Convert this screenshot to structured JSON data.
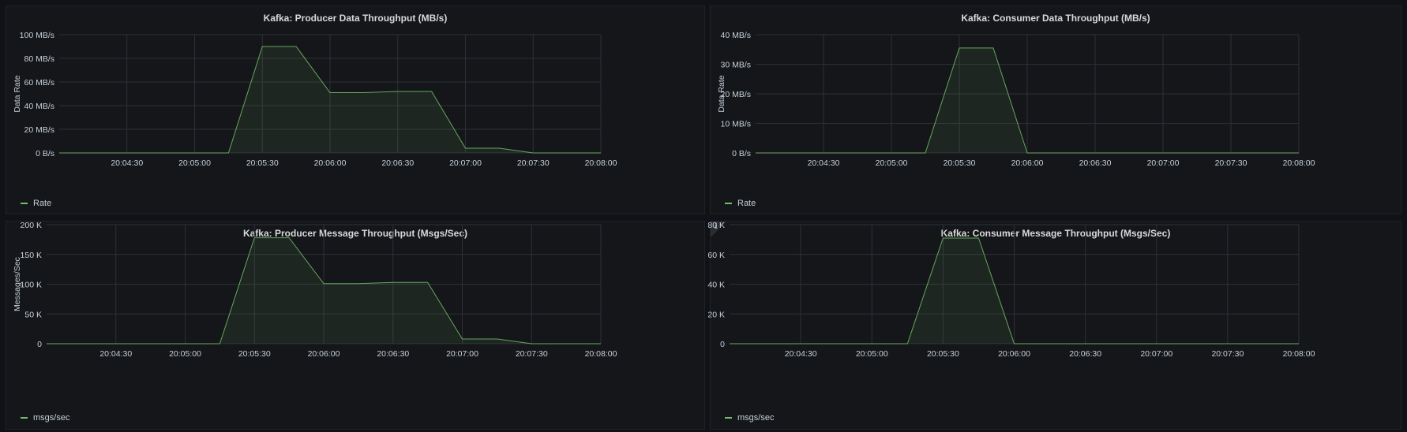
{
  "theme": {
    "background": "#111217",
    "panel_background": "#141619",
    "series_color": "#73bf69",
    "grid_color": "#2c3036",
    "text_color": "#c7d0d9"
  },
  "panels": [
    {
      "title": "Kafka: Producer Data Throughput (MB/s)",
      "legend_label": "Rate",
      "has_info_icon": false,
      "info_icon": ""
    },
    {
      "title": "Kafka: Consumer Data Throughput (MB/s)",
      "legend_label": "Rate",
      "has_info_icon": false,
      "info_icon": ""
    },
    {
      "title": "Kafka: Producer Message Throughput (Msgs/Sec)",
      "legend_label": "msgs/sec",
      "has_info_icon": false,
      "info_icon": ""
    },
    {
      "title": "Kafka: Consumer Message Throughput (Msgs/Sec)",
      "legend_label": "msgs/sec",
      "has_info_icon": true,
      "info_icon": "ℹ"
    }
  ],
  "chart_data": [
    {
      "type": "area",
      "title": "Kafka: Producer Data Throughput (MB/s)",
      "xlabel": "",
      "ylabel": "Data Rate",
      "ylim": [
        0,
        100
      ],
      "xlim": [
        "20:04:00",
        "20:08:00"
      ],
      "x_ticks": [
        "20:04:30",
        "20:05:00",
        "20:05:30",
        "20:06:00",
        "20:06:30",
        "20:07:00",
        "20:07:30",
        "20:08:00"
      ],
      "y_ticks": [
        0,
        20,
        40,
        60,
        80,
        100
      ],
      "y_tick_labels": [
        "0 B/s",
        "20 MB/s",
        "40 MB/s",
        "60 MB/s",
        "80 MB/s",
        "100 MB/s"
      ],
      "grid": true,
      "legend": "bottom-left",
      "series": [
        {
          "name": "Rate",
          "x": [
            "20:04:00",
            "20:05:15",
            "20:05:30",
            "20:05:45",
            "20:06:00",
            "20:06:15",
            "20:06:30",
            "20:06:45",
            "20:07:00",
            "20:07:15",
            "20:07:30",
            "20:08:00"
          ],
          "values": [
            0,
            0,
            90,
            90,
            51,
            51,
            52,
            52,
            4,
            4,
            0,
            0
          ]
        }
      ]
    },
    {
      "type": "area",
      "title": "Kafka: Consumer Data Throughput (MB/s)",
      "xlabel": "",
      "ylabel": "Data Rate",
      "ylim": [
        0,
        40
      ],
      "xlim": [
        "20:04:00",
        "20:08:00"
      ],
      "x_ticks": [
        "20:04:30",
        "20:05:00",
        "20:05:30",
        "20:06:00",
        "20:06:30",
        "20:07:00",
        "20:07:30",
        "20:08:00"
      ],
      "y_ticks": [
        0,
        10,
        20,
        30,
        40
      ],
      "y_tick_labels": [
        "0 B/s",
        "10 MB/s",
        "20 MB/s",
        "30 MB/s",
        "40 MB/s"
      ],
      "grid": true,
      "legend": "bottom-left",
      "series": [
        {
          "name": "Rate",
          "x": [
            "20:04:00",
            "20:05:15",
            "20:05:30",
            "20:05:45",
            "20:06:00",
            "20:08:00"
          ],
          "values": [
            0,
            0,
            35.5,
            35.5,
            0,
            0
          ]
        }
      ]
    },
    {
      "type": "area",
      "title": "Kafka: Producer Message Throughput (Msgs/Sec)",
      "xlabel": "",
      "ylabel": "Messages/Sec",
      "ylim": [
        0,
        200000
      ],
      "xlim": [
        "20:04:00",
        "20:08:00"
      ],
      "x_ticks": [
        "20:04:30",
        "20:05:00",
        "20:05:30",
        "20:06:00",
        "20:06:30",
        "20:07:00",
        "20:07:30",
        "20:08:00"
      ],
      "y_ticks": [
        0,
        50000,
        100000,
        150000,
        200000
      ],
      "y_tick_labels": [
        "0",
        "50 K",
        "100 K",
        "150 K",
        "200 K"
      ],
      "grid": true,
      "legend": "bottom-left",
      "series": [
        {
          "name": "msgs/sec",
          "x": [
            "20:04:00",
            "20:05:15",
            "20:05:30",
            "20:05:45",
            "20:06:00",
            "20:06:15",
            "20:06:30",
            "20:06:45",
            "20:07:00",
            "20:07:15",
            "20:07:30",
            "20:08:00"
          ],
          "values": [
            0,
            0,
            178000,
            178000,
            101000,
            101000,
            103000,
            103000,
            8000,
            8000,
            0,
            0
          ]
        }
      ]
    },
    {
      "type": "area",
      "title": "Kafka: Consumer Message Throughput (Msgs/Sec)",
      "xlabel": "",
      "ylabel": "",
      "ylim": [
        0,
        80000
      ],
      "xlim": [
        "20:04:00",
        "20:08:00"
      ],
      "x_ticks": [
        "20:04:30",
        "20:05:00",
        "20:05:30",
        "20:06:00",
        "20:06:30",
        "20:07:00",
        "20:07:30",
        "20:08:00"
      ],
      "y_ticks": [
        0,
        20000,
        40000,
        60000,
        80000
      ],
      "y_tick_labels": [
        "0",
        "20 K",
        "40 K",
        "60 K",
        "80 K"
      ],
      "grid": true,
      "legend": "bottom-left",
      "series": [
        {
          "name": "msgs/sec",
          "x": [
            "20:04:00",
            "20:05:15",
            "20:05:30",
            "20:05:45",
            "20:06:00",
            "20:08:00"
          ],
          "values": [
            0,
            0,
            71000,
            71000,
            0,
            0
          ]
        }
      ]
    }
  ]
}
